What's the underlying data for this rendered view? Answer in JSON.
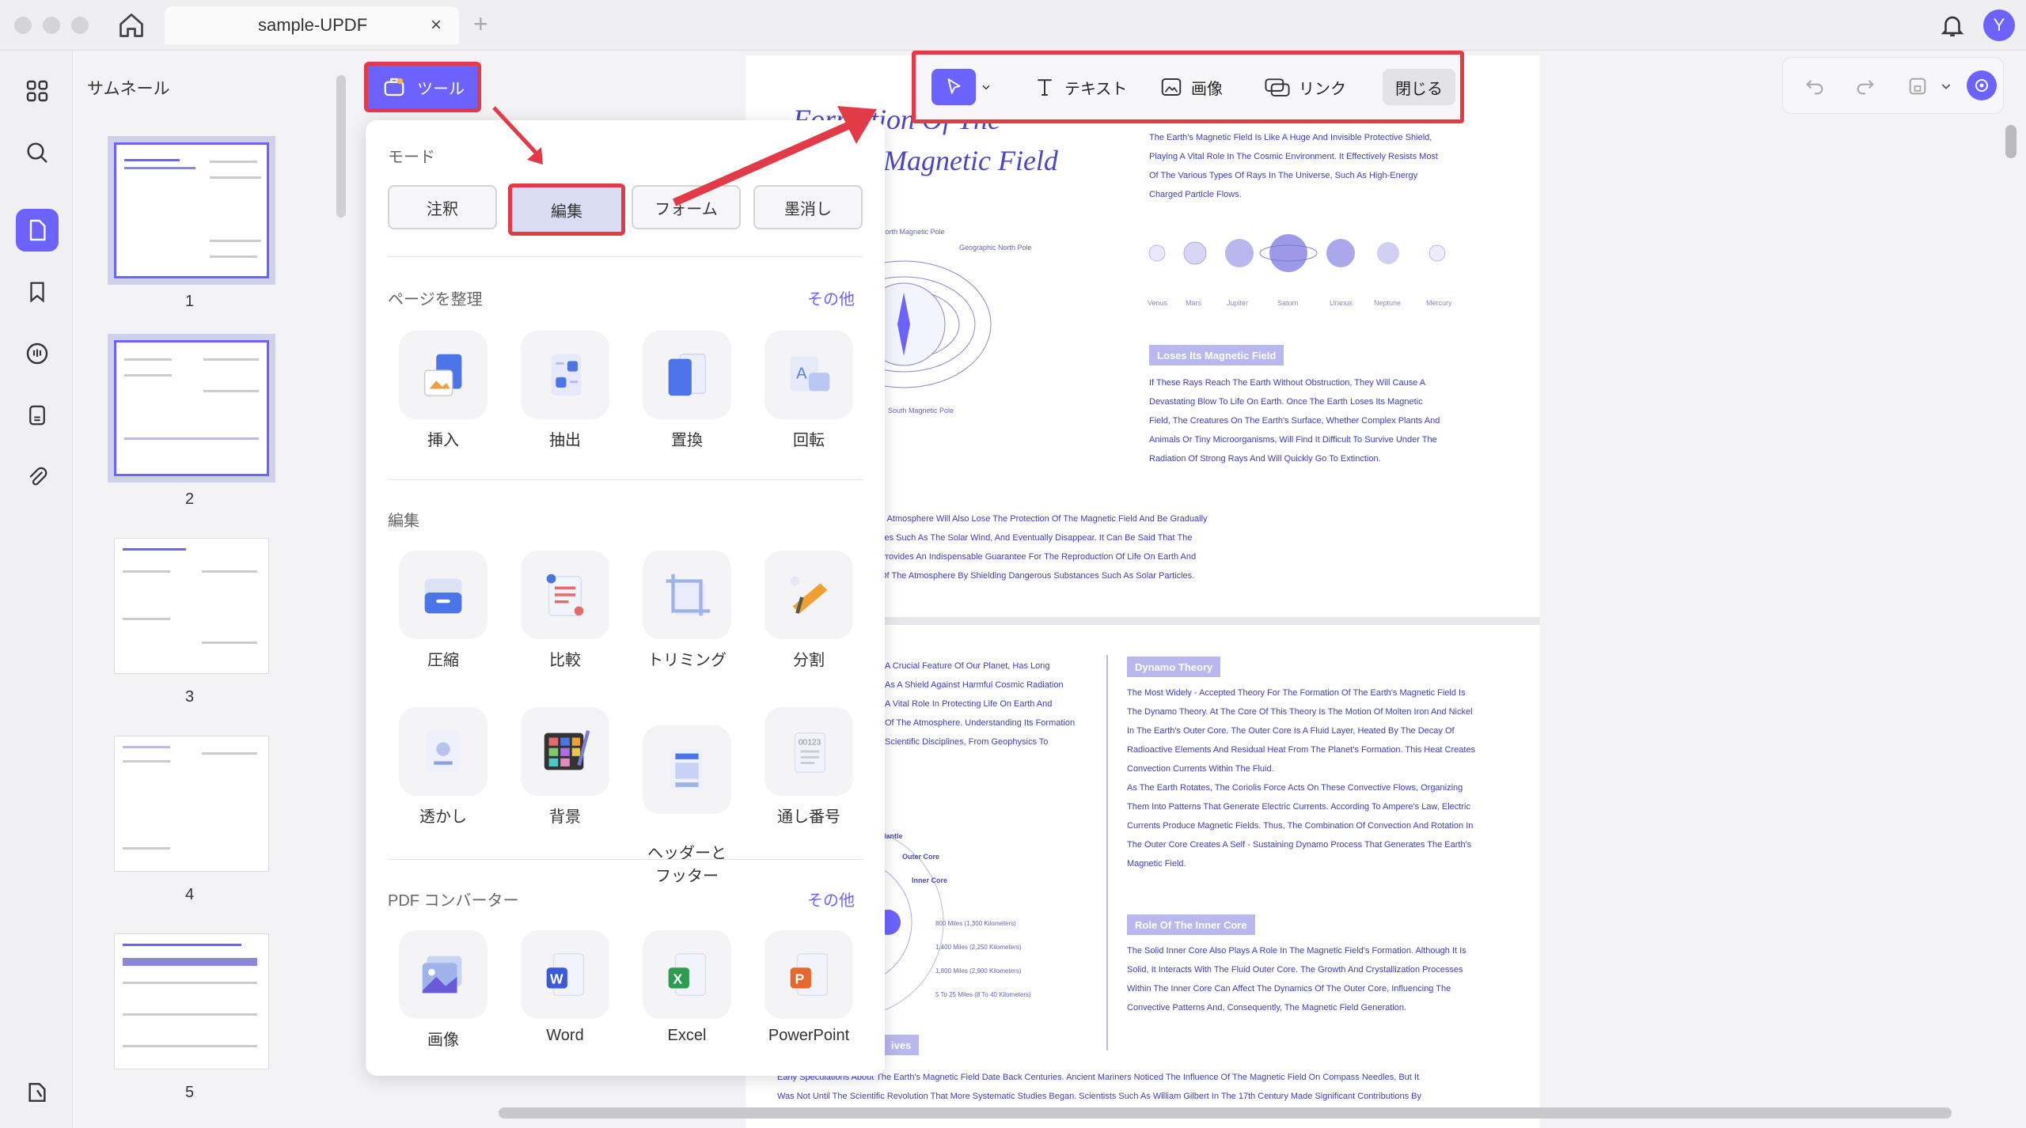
{
  "window": {
    "tab_title": "sample-UPDF",
    "avatar": "Y"
  },
  "thumbnails": {
    "title": "サムネール",
    "pages": [
      "1",
      "2",
      "3",
      "4",
      "5"
    ]
  },
  "tools_button": {
    "label": "ツール"
  },
  "panel": {
    "mode_label": "モード",
    "modes": [
      "注釈",
      "編集",
      "フォーム",
      "墨消し"
    ],
    "organize_label": "ページを整理",
    "organize_more": "その他",
    "organize": [
      "挿入",
      "抽出",
      "置換",
      "回転"
    ],
    "edit_label": "編集",
    "edit_row1": [
      "圧縮",
      "比較",
      "トリミング",
      "分割"
    ],
    "edit_row2": [
      "透かし",
      "背景",
      "ヘッダーと\nフッター",
      "通し番号"
    ],
    "converter_label": "PDF コンバーター",
    "converter_more": "その他",
    "converter": [
      "画像",
      "Word",
      "Excel",
      "PowerPoint"
    ]
  },
  "edit_toolbar": {
    "text": "テキスト",
    "image": "画像",
    "link": "リンク",
    "close": "閉じる"
  },
  "document": {
    "title1": "Formation Of The",
    "title2": "Magnetic Field",
    "p1": [
      "The Earth's Magnetic Field Is Like A Huge And Invisible Protective Shield,",
      "Playing A Vital Role In The Cosmic Environment. It Effectively Resists Most",
      "Of The Various Types Of Rays In The Universe, Such As High-Energy",
      "Charged Particle Flows."
    ],
    "planets": [
      "Venus",
      "Mars",
      "Jupiter",
      "Saturn",
      "Uranus",
      "Neptune",
      "Mercury"
    ],
    "h_loses": "Loses Its Magnetic Field",
    "p2": [
      "If These Rays Reach The Earth Without Obstruction, They Will Cause A",
      "Devastating Blow To Life On Earth. Once The Earth Loses Its Magnetic",
      "Field, The Creatures On The Earth's Surface, Whether Complex Plants And",
      "Animals Or Tiny Microorganisms, Will Find It Difficult To Survive Under The",
      "Radiation Of Strong Rays And Will Quickly Go To Extinction."
    ],
    "p3": [
      "e Atmosphere Will Also Lose The Protection Of The Magnetic Field And Be Gradually",
      "ces Such As The Solar Wind, And Eventually Disappear. It Can Be Said That The",
      "Provides An Indispensable Guarantee For The Reproduction Of Life On Earth And",
      "Of The Atmosphere By Shielding Dangerous Substances Such As Solar Particles."
    ],
    "diagram_labels": {
      "north": "North Magnetic Pole",
      "geo": "Geographic North Pole",
      "south": "South Magnetic Pole"
    },
    "h_dynamo": "Dynamo Theory",
    "p4": [
      "The Most Widely - Accepted Theory For The Formation Of The Earth's Magnetic Field Is",
      "The Dynamo Theory. At The Core Of This Theory Is The Motion Of Molten Iron And Nickel",
      "In The Earth's Outer Core. The Outer Core Is A Fluid Layer, Heated By The Decay Of",
      "Radioactive Elements And Residual Heat From The Planet's Formation. This Heat Creates",
      "Convection Currents Within The Fluid.",
      "As The Earth Rotates, The Coriolis Force Acts On These Convective Flows, Organizing",
      "Them Into Patterns That Generate Electric Currents. According To Ampere's Law, Electric",
      "Currents Produce Magnetic Fields. Thus, The Combination Of Convection And Rotation In",
      "The Outer Core Creates A Self - Sustaining Dynamo Process That Generates The Earth's",
      "Magnetic Field."
    ],
    "p5": [
      "A Crucial Feature Of Our Planet, Has Long",
      "As A Shield Against Harmful Cosmic Radiation",
      "A Vital Role In Protecting Life On Earth And",
      "Of The Atmosphere. Understanding Its Formation",
      "Scientific Disciplines, From Geophysics To"
    ],
    "layers": [
      "Mantle",
      "Outer Core",
      "Inner Core"
    ],
    "depths": [
      "800 Miles (1,300 Kilometers)",
      "1,400 Miles (2,250 Kilometers)",
      "1,800 Miles (2,900 Kilometers)",
      "5 To 25 Miles (8 To 40 Kilometers)"
    ],
    "h_inner": "Role Of The Inner Core",
    "p6": [
      "The Solid Inner Core Also Plays A Role In The Magnetic Field's Formation. Although It Is",
      "Solid, It Interacts With The Fluid Outer Core. The Growth And Crystallization Processes",
      "Within The Inner Core Can Affect The Dynamics Of The Outer Core, Influencing The",
      "Convective Patterns And, Consequently, The Magnetic Field Generation."
    ],
    "h_ives": "ives",
    "p7": [
      "Early Speculations About The Earth's Magnetic Field Date Back Centuries. Ancient Mariners Noticed The Influence Of The Magnetic Field On Compass Needles, But It",
      "Was Not Until The Scientific Revolution That More Systematic Studies Began. Scientists Such As William Gilbert In The 17th Century Made Significant Contributions By"
    ]
  },
  "colors": {
    "accent": "#6c63ff",
    "highlight": "#e23b47"
  }
}
